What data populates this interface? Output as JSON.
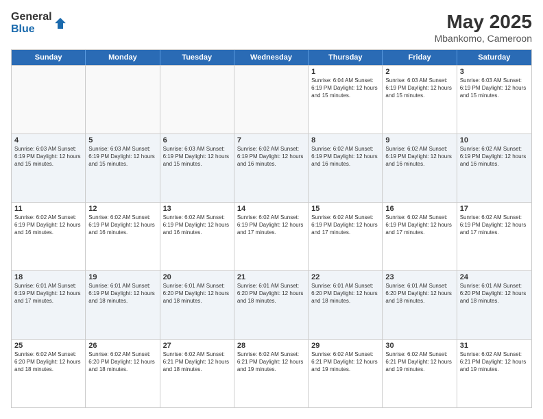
{
  "logo": {
    "general": "General",
    "blue": "Blue"
  },
  "title": "May 2025",
  "subtitle": "Mbankomo, Cameroon",
  "headers": [
    "Sunday",
    "Monday",
    "Tuesday",
    "Wednesday",
    "Thursday",
    "Friday",
    "Saturday"
  ],
  "weeks": [
    [
      {
        "day": "",
        "info": ""
      },
      {
        "day": "",
        "info": ""
      },
      {
        "day": "",
        "info": ""
      },
      {
        "day": "",
        "info": ""
      },
      {
        "day": "1",
        "info": "Sunrise: 6:04 AM\nSunset: 6:19 PM\nDaylight: 12 hours\nand 15 minutes."
      },
      {
        "day": "2",
        "info": "Sunrise: 6:03 AM\nSunset: 6:19 PM\nDaylight: 12 hours\nand 15 minutes."
      },
      {
        "day": "3",
        "info": "Sunrise: 6:03 AM\nSunset: 6:19 PM\nDaylight: 12 hours\nand 15 minutes."
      }
    ],
    [
      {
        "day": "4",
        "info": "Sunrise: 6:03 AM\nSunset: 6:19 PM\nDaylight: 12 hours\nand 15 minutes."
      },
      {
        "day": "5",
        "info": "Sunrise: 6:03 AM\nSunset: 6:19 PM\nDaylight: 12 hours\nand 15 minutes."
      },
      {
        "day": "6",
        "info": "Sunrise: 6:03 AM\nSunset: 6:19 PM\nDaylight: 12 hours\nand 15 minutes."
      },
      {
        "day": "7",
        "info": "Sunrise: 6:02 AM\nSunset: 6:19 PM\nDaylight: 12 hours\nand 16 minutes."
      },
      {
        "day": "8",
        "info": "Sunrise: 6:02 AM\nSunset: 6:19 PM\nDaylight: 12 hours\nand 16 minutes."
      },
      {
        "day": "9",
        "info": "Sunrise: 6:02 AM\nSunset: 6:19 PM\nDaylight: 12 hours\nand 16 minutes."
      },
      {
        "day": "10",
        "info": "Sunrise: 6:02 AM\nSunset: 6:19 PM\nDaylight: 12 hours\nand 16 minutes."
      }
    ],
    [
      {
        "day": "11",
        "info": "Sunrise: 6:02 AM\nSunset: 6:19 PM\nDaylight: 12 hours\nand 16 minutes."
      },
      {
        "day": "12",
        "info": "Sunrise: 6:02 AM\nSunset: 6:19 PM\nDaylight: 12 hours\nand 16 minutes."
      },
      {
        "day": "13",
        "info": "Sunrise: 6:02 AM\nSunset: 6:19 PM\nDaylight: 12 hours\nand 16 minutes."
      },
      {
        "day": "14",
        "info": "Sunrise: 6:02 AM\nSunset: 6:19 PM\nDaylight: 12 hours\nand 17 minutes."
      },
      {
        "day": "15",
        "info": "Sunrise: 6:02 AM\nSunset: 6:19 PM\nDaylight: 12 hours\nand 17 minutes."
      },
      {
        "day": "16",
        "info": "Sunrise: 6:02 AM\nSunset: 6:19 PM\nDaylight: 12 hours\nand 17 minutes."
      },
      {
        "day": "17",
        "info": "Sunrise: 6:02 AM\nSunset: 6:19 PM\nDaylight: 12 hours\nand 17 minutes."
      }
    ],
    [
      {
        "day": "18",
        "info": "Sunrise: 6:01 AM\nSunset: 6:19 PM\nDaylight: 12 hours\nand 17 minutes."
      },
      {
        "day": "19",
        "info": "Sunrise: 6:01 AM\nSunset: 6:19 PM\nDaylight: 12 hours\nand 18 minutes."
      },
      {
        "day": "20",
        "info": "Sunrise: 6:01 AM\nSunset: 6:20 PM\nDaylight: 12 hours\nand 18 minutes."
      },
      {
        "day": "21",
        "info": "Sunrise: 6:01 AM\nSunset: 6:20 PM\nDaylight: 12 hours\nand 18 minutes."
      },
      {
        "day": "22",
        "info": "Sunrise: 6:01 AM\nSunset: 6:20 PM\nDaylight: 12 hours\nand 18 minutes."
      },
      {
        "day": "23",
        "info": "Sunrise: 6:01 AM\nSunset: 6:20 PM\nDaylight: 12 hours\nand 18 minutes."
      },
      {
        "day": "24",
        "info": "Sunrise: 6:01 AM\nSunset: 6:20 PM\nDaylight: 12 hours\nand 18 minutes."
      }
    ],
    [
      {
        "day": "25",
        "info": "Sunrise: 6:02 AM\nSunset: 6:20 PM\nDaylight: 12 hours\nand 18 minutes."
      },
      {
        "day": "26",
        "info": "Sunrise: 6:02 AM\nSunset: 6:20 PM\nDaylight: 12 hours\nand 18 minutes."
      },
      {
        "day": "27",
        "info": "Sunrise: 6:02 AM\nSunset: 6:21 PM\nDaylight: 12 hours\nand 18 minutes."
      },
      {
        "day": "28",
        "info": "Sunrise: 6:02 AM\nSunset: 6:21 PM\nDaylight: 12 hours\nand 19 minutes."
      },
      {
        "day": "29",
        "info": "Sunrise: 6:02 AM\nSunset: 6:21 PM\nDaylight: 12 hours\nand 19 minutes."
      },
      {
        "day": "30",
        "info": "Sunrise: 6:02 AM\nSunset: 6:21 PM\nDaylight: 12 hours\nand 19 minutes."
      },
      {
        "day": "31",
        "info": "Sunrise: 6:02 AM\nSunset: 6:21 PM\nDaylight: 12 hours\nand 19 minutes."
      }
    ]
  ]
}
